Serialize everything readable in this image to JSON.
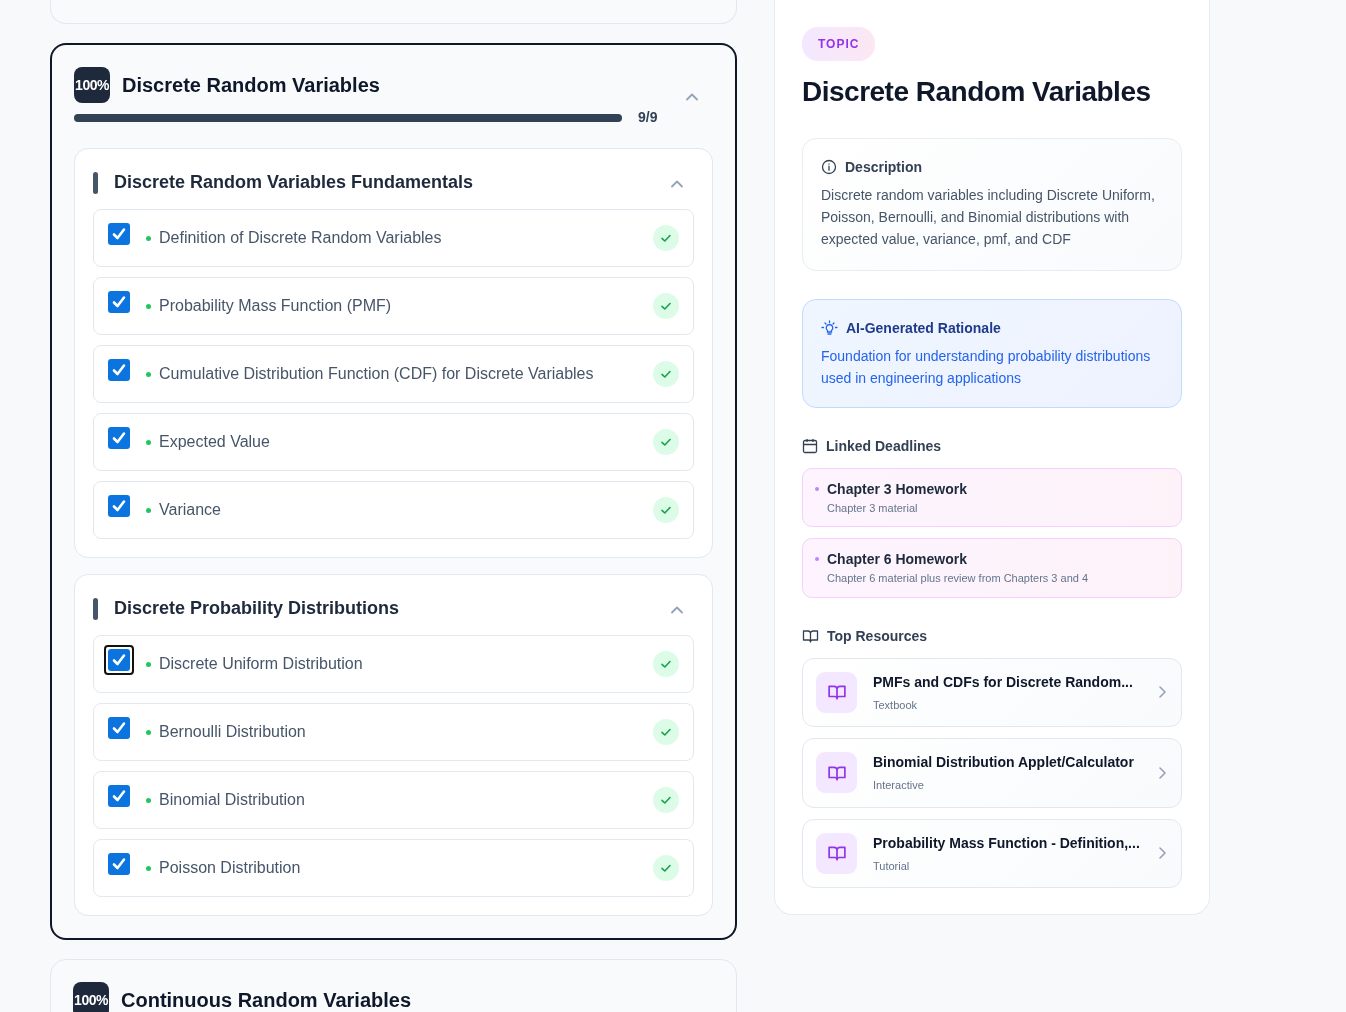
{
  "topic": {
    "badge": "100%",
    "title": "Discrete Random Variables",
    "expanded": true,
    "progress": {
      "level": 1,
      "reading": "9/9"
    },
    "sections": [
      {
        "title": "Discrete Random Variables Fundamentals",
        "expanded": true,
        "items": [
          {
            "label": "Definition of Discrete Random Variables",
            "checked": true,
            "focused": false,
            "done": true
          },
          {
            "label": "Probability Mass Function (PMF)",
            "checked": true,
            "focused": false,
            "done": true
          },
          {
            "label": "Cumulative Distribution Function (CDF) for Discrete Variables",
            "checked": true,
            "focused": false,
            "done": true
          },
          {
            "label": "Expected Value",
            "checked": true,
            "focused": false,
            "done": true
          },
          {
            "label": "Variance",
            "checked": true,
            "focused": false,
            "done": true
          }
        ]
      },
      {
        "title": "Discrete Probability Distributions",
        "expanded": true,
        "items": [
          {
            "label": "Discrete Uniform Distribution",
            "checked": true,
            "focused": true,
            "done": true
          },
          {
            "label": "Bernoulli Distribution",
            "checked": true,
            "focused": false,
            "done": true
          },
          {
            "label": "Binomial Distribution",
            "checked": true,
            "focused": false,
            "done": true
          },
          {
            "label": "Poisson Distribution",
            "checked": true,
            "focused": false,
            "done": true
          }
        ]
      }
    ]
  },
  "next_topic": {
    "badge": "100%",
    "title": "Continuous Random Variables"
  },
  "detail": {
    "tag": "TOPIC",
    "title": "Discrete Random Variables",
    "description": {
      "heading": "Description",
      "text": "Discrete random variables including Discrete Uniform, Poisson, Bernoulli, and Binomial distributions with expected value, variance, pmf, and CDF"
    },
    "rationale": {
      "heading": "AI-Generated Rationale",
      "text": "Foundation for understanding probability distributions used in engineering applications"
    },
    "deadlines": {
      "heading": "Linked Deadlines",
      "items": [
        {
          "title": "Chapter 3 Homework",
          "subtitle": "Chapter 3 material"
        },
        {
          "title": "Chapter 6 Homework",
          "subtitle": "Chapter 6 material plus review from Chapters 3 and 4"
        }
      ]
    },
    "resources": {
      "heading": "Top Resources",
      "items": [
        {
          "title": "PMFs and CDFs for Discrete Random...",
          "type": "Textbook"
        },
        {
          "title": "Binomial Distribution Applet/Calculator",
          "type": "Interactive"
        },
        {
          "title": "Probability Mass Function - Definition,...",
          "type": "Tutorial"
        }
      ]
    }
  }
}
